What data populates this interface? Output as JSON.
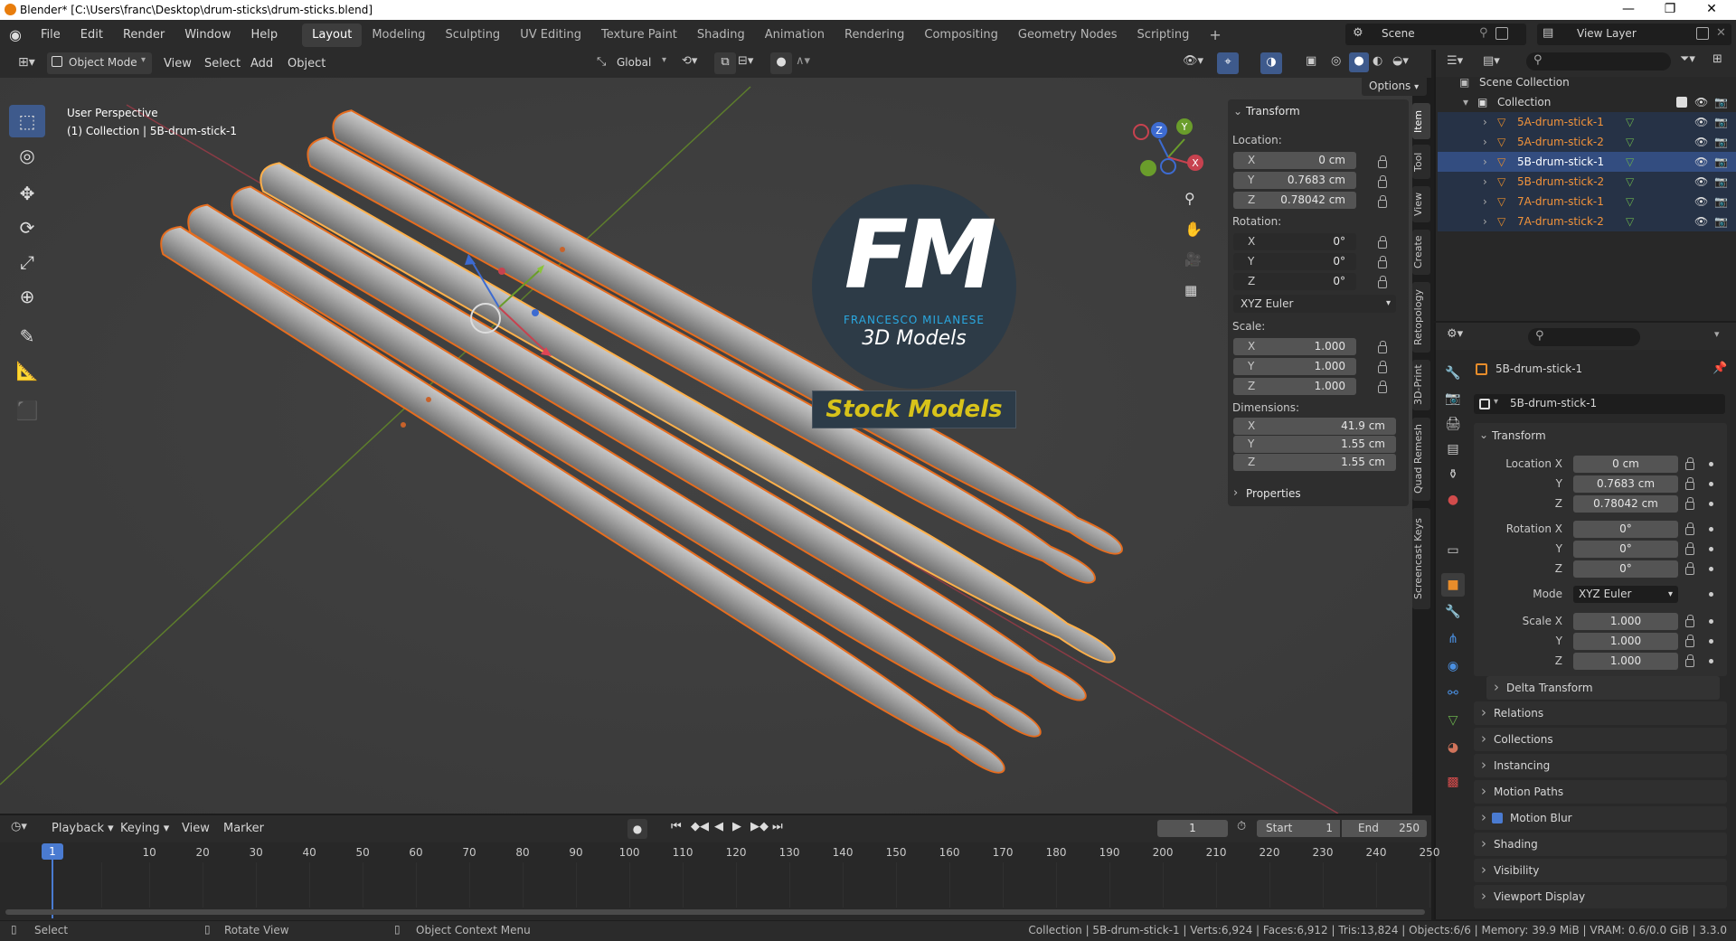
{
  "window": {
    "title": "Blender* [C:\\Users\\franc\\Desktop\\drum-sticks\\drum-sticks.blend]",
    "minimize": "—",
    "maximize": "❐",
    "close": "✕"
  },
  "menu": [
    "File",
    "Edit",
    "Render",
    "Window",
    "Help"
  ],
  "workspaces": [
    "Layout",
    "Modeling",
    "Sculpting",
    "UV Editing",
    "Texture Paint",
    "Shading",
    "Animation",
    "Rendering",
    "Compositing",
    "Geometry Nodes",
    "Scripting",
    "+"
  ],
  "scene": {
    "label": "Scene",
    "view_layer": "View Layer"
  },
  "viewport_header": {
    "mode": "Object Mode",
    "menus": [
      "View",
      "Select",
      "Add",
      "Object"
    ],
    "orientation": "Global",
    "options": "Options"
  },
  "viewport": {
    "perspective": "User Perspective",
    "collection_info": "(1) Collection | 5B-drum-stick-1"
  },
  "logo": {
    "letters": "FM",
    "name": "FRANCESCO MILANESE",
    "sub": "3D Models",
    "banner": "Stock Models"
  },
  "sidebar_tabs": [
    "Item",
    "Tool",
    "View",
    "Create",
    "Retopology",
    "3D-Print",
    "Quad Remesh",
    "Screencast Keys"
  ],
  "npanel": {
    "title": "Transform",
    "location_label": "Location:",
    "location": {
      "x": "0 cm",
      "y": "0.7683 cm",
      "z": "0.78042 cm"
    },
    "rotation_label": "Rotation:",
    "rotation": {
      "x": "0°",
      "y": "0°",
      "z": "0°"
    },
    "rotation_mode": "XYZ Euler",
    "scale_label": "Scale:",
    "scale": {
      "x": "1.000",
      "y": "1.000",
      "z": "1.000"
    },
    "dimensions_label": "Dimensions:",
    "dimensions": {
      "x": "41.9 cm",
      "y": "1.55 cm",
      "z": "1.55 cm"
    },
    "properties": "Properties",
    "axis": {
      "x": "X",
      "y": "Y",
      "z": "Z"
    }
  },
  "outliner": {
    "scene_collection": "Scene Collection",
    "collection": "Collection",
    "items": [
      "5A-drum-stick-1",
      "5A-drum-stick-2",
      "5B-drum-stick-1",
      "5B-drum-stick-2",
      "7A-drum-stick-1",
      "7A-drum-stick-2"
    ],
    "selected_index": 2
  },
  "properties": {
    "object_name": "5B-drum-stick-1",
    "data_name": "5B-drum-stick-1",
    "transform": "Transform",
    "location_x_label": "Location X",
    "y_label": "Y",
    "z_label": "Z",
    "rotation_x_label": "Rotation X",
    "mode_label": "Mode",
    "mode": "XYZ Euler",
    "scale_x_label": "Scale X",
    "loc": [
      "0 cm",
      "0.7683 cm",
      "0.78042 cm"
    ],
    "rot": [
      "0°",
      "0°",
      "0°"
    ],
    "scale": [
      "1.000",
      "1.000",
      "1.000"
    ],
    "delta": "Delta Transform",
    "sections": [
      "Relations",
      "Collections",
      "Instancing",
      "Motion Paths",
      "Motion Blur",
      "Shading",
      "Visibility",
      "Viewport Display"
    ]
  },
  "timeline": {
    "menus": [
      "Playback",
      "Keying",
      "View",
      "Marker"
    ],
    "current": "1",
    "start_label": "Start",
    "start": "1",
    "end_label": "End",
    "end": "250",
    "ticks": [
      "1",
      "10",
      "20",
      "30",
      "40",
      "50",
      "60",
      "70",
      "80",
      "90",
      "100",
      "110",
      "120",
      "130",
      "140",
      "150",
      "160",
      "170",
      "180",
      "190",
      "200",
      "210",
      "220",
      "230",
      "240",
      "250"
    ]
  },
  "statusbar": {
    "select": "Select",
    "rotate": "Rotate View",
    "context": "Object Context Menu",
    "stats": "Collection | 5B-drum-stick-1 | Verts:6,924 | Faces:6,912 | Tris:13,824 | Objects:6/6 | Memory: 39.9 MiB | VRAM: 0.6/0.0 GiB | 3.3.0"
  },
  "colors": {
    "selection": "#e66d1f",
    "active": "#ffb04a",
    "axis_x": "#c7424f",
    "axis_y": "#6a9d2b",
    "highlight_row": "#334d80"
  }
}
